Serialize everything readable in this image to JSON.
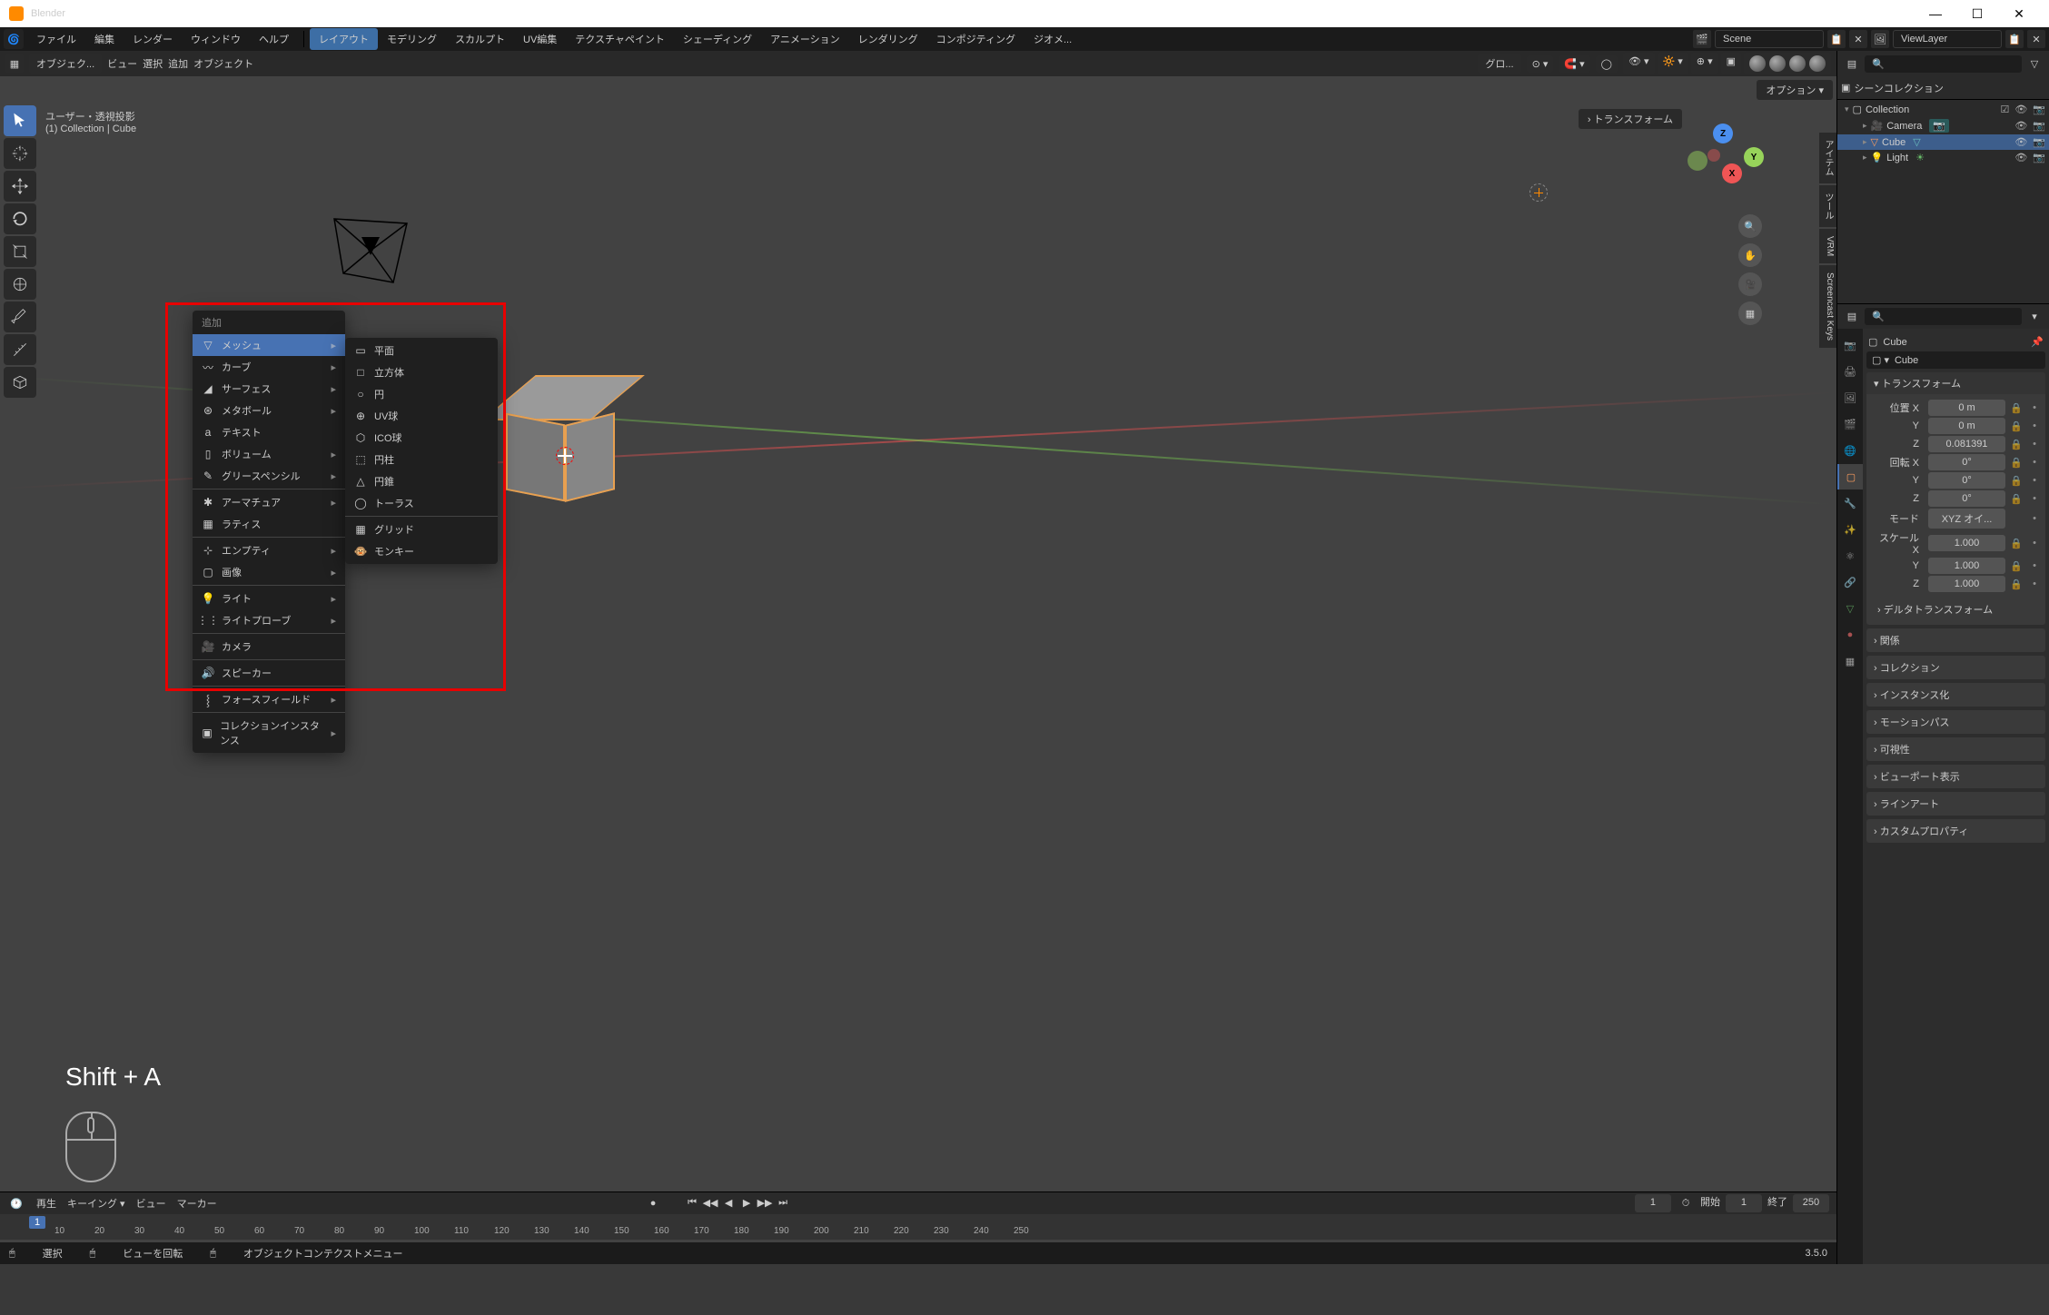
{
  "app": {
    "title": "Blender"
  },
  "winbuttons": {
    "min": "—",
    "max": "☐",
    "close": "✕"
  },
  "menu": {
    "file": "ファイル",
    "edit": "編集",
    "render": "レンダー",
    "window": "ウィンドウ",
    "help": "ヘルプ"
  },
  "workspaces": [
    "レイアウト",
    "モデリング",
    "スカルプト",
    "UV編集",
    "テクスチャペイント",
    "シェーディング",
    "アニメーション",
    "レンダリング",
    "コンポジティング",
    "ジオメ..."
  ],
  "scene": {
    "label": "Scene",
    "layer": "ViewLayer"
  },
  "vpheader": {
    "mode": "オブジェク...",
    "view": "ビュー",
    "select": "選択",
    "add": "追加",
    "object": "オブジェクト",
    "orient": "グロ...",
    "options": "オプション",
    "transform": "トランスフォーム"
  },
  "info": {
    "line1": "ユーザー・透視投影",
    "line2": "(1) Collection | Cube"
  },
  "sideTabs": [
    "アイテム",
    "ツール",
    "VRM",
    "Screencast Keys"
  ],
  "shortcut": "Shift + A",
  "addmenu": {
    "title": "追加",
    "items": [
      "メッシュ",
      "カーブ",
      "サーフェス",
      "メタボール",
      "テキスト",
      "ボリューム",
      "グリースペンシル",
      "アーマチュア",
      "ラティス",
      "エンプティ",
      "画像",
      "ライト",
      "ライトプローブ",
      "カメラ",
      "スピーカー",
      "フォースフィールド",
      "コレクションインスタンス"
    ]
  },
  "meshsub": [
    "平面",
    "立方体",
    "円",
    "UV球",
    "ICO球",
    "円柱",
    "円錐",
    "トーラス",
    "グリッド",
    "モンキー"
  ],
  "timeline": {
    "play": "再生",
    "keying": "キーイング",
    "view": "ビュー",
    "marker": "マーカー",
    "cur": "1",
    "start_label": "開始",
    "start": "1",
    "end_label": "終了",
    "end": "250",
    "marks": [
      "10",
      "20",
      "30",
      "40",
      "50",
      "60",
      "70",
      "80",
      "90",
      "100",
      "110",
      "120",
      "130",
      "140",
      "150",
      "160",
      "170",
      "180",
      "190",
      "200",
      "210",
      "220",
      "230",
      "240",
      "250"
    ]
  },
  "status": {
    "select": "選択",
    "rotate": "ビューを回転",
    "context": "オブジェクトコンテクストメニュー",
    "version": "3.5.0"
  },
  "outliner": {
    "title": "シーンコレクション",
    "collection": "Collection",
    "camera": "Camera",
    "cube": "Cube",
    "light": "Light"
  },
  "props": {
    "name": "Cube",
    "dataname": "Cube",
    "transform": "トランスフォーム",
    "posX": "位置 X",
    "posY": "Y",
    "posZ": "Z",
    "posXv": "0 m",
    "posYv": "0 m",
    "posZv": "0.081391",
    "rotX": "回転 X",
    "rotY": "Y",
    "rotZ": "Z",
    "rotXv": "0°",
    "rotYv": "0°",
    "rotZv": "0°",
    "mode": "モード",
    "modev": "XYZ オイ...",
    "scaleX": "スケール X",
    "scaleY": "Y",
    "scaleZ": "Z",
    "scaleXv": "1.000",
    "scaleYv": "1.000",
    "scaleZv": "1.000",
    "delta": "デルタトランスフォーム",
    "panels": [
      "関係",
      "コレクション",
      "インスタンス化",
      "モーションパス",
      "可視性",
      "ビューポート表示",
      "ラインアート",
      "カスタムプロパティ"
    ]
  }
}
